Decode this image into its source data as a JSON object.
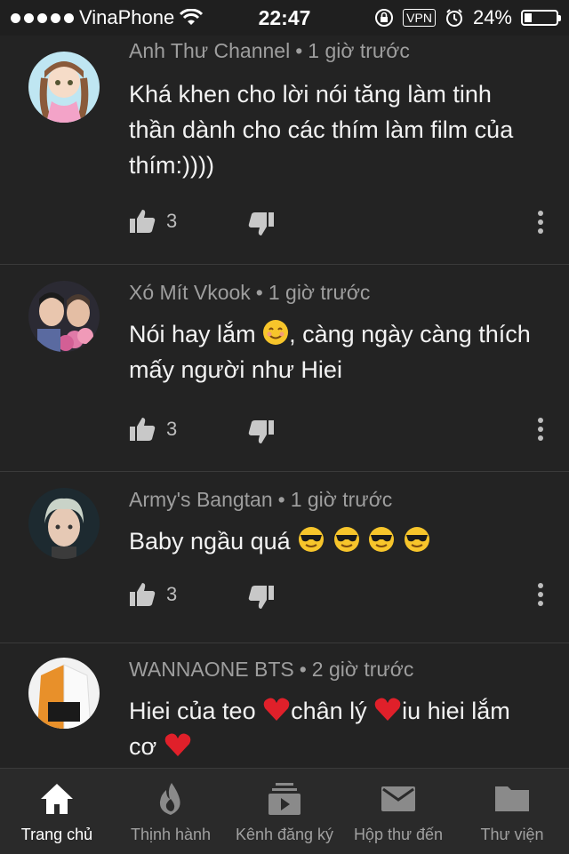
{
  "status_bar": {
    "carrier": "VinaPhone",
    "time": "22:47",
    "vpn": "VPN",
    "battery_text": "24%",
    "battery_level": 0.24,
    "signal_bars": 5
  },
  "comments": [
    {
      "author": "Anh Thư Channel",
      "time": "1 giờ trước",
      "text": "Khá khen cho lời nói tăng làm tinh thần dành cho các thím làm film của thím:))))",
      "likes": "3"
    },
    {
      "author": "Xó Mít Vkook",
      "time": "1 giờ trước",
      "text_before": "Nói hay lắm ",
      "text_after": ", càng ngày càng thích mấy người như Hiei",
      "likes": "3"
    },
    {
      "author": "Army's Bangtan",
      "time": "1 giờ trước",
      "text": "Baby ngầu quá",
      "likes": "3"
    },
    {
      "author": "WANNAONE BTS",
      "time": "2 giờ trước",
      "text_part1": "Hiei của teo ",
      "text_part2": "chân lý ",
      "text_part3": "iu hiei lắm cơ "
    }
  ],
  "tabs": [
    {
      "label": "Trang chủ",
      "icon": "home-icon",
      "active": true
    },
    {
      "label": "Thịnh hành",
      "icon": "flame-icon",
      "active": false
    },
    {
      "label": "Kênh đăng ký",
      "icon": "subscriptions-icon",
      "active": false
    },
    {
      "label": "Hộp thư đến",
      "icon": "mail-icon",
      "active": false
    },
    {
      "label": "Thư viện",
      "icon": "folder-icon",
      "active": false
    }
  ],
  "colors": {
    "background": "#232323",
    "tabbar": "#2a2a2a",
    "meta_text": "#9e9e9e",
    "heart": "#e0202a",
    "emoji_yellow": "#f7c52b"
  }
}
